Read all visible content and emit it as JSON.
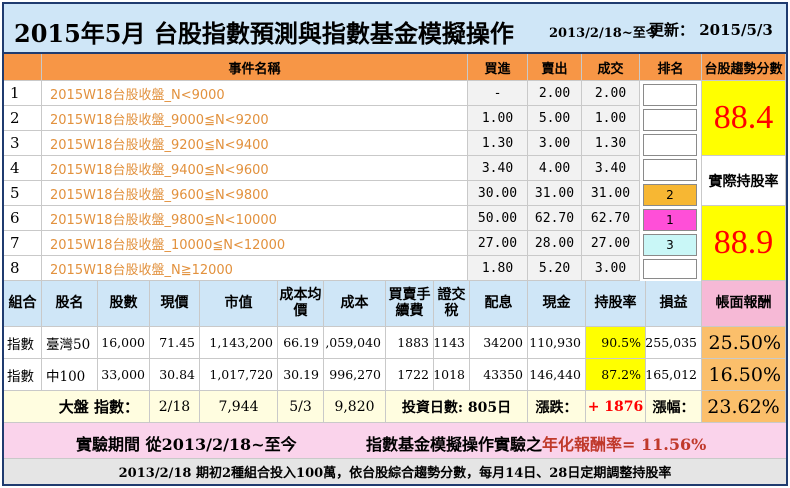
{
  "title": {
    "main": "2015年5月 台股指數預測與指數基金模擬操作",
    "range": "2013/2/18~至今",
    "update_label": "更新：",
    "update_date": "2015/5/3"
  },
  "header": {
    "event": "事件名稱",
    "buy": "買進",
    "sell": "賣出",
    "deal": "成交",
    "rank": "排名",
    "trend_score": "台股趨勢分數"
  },
  "events": [
    {
      "num": "1",
      "name": "2015W18台股收盤_N<9000",
      "buy": "-",
      "sell": "2.00",
      "deal": "2.00"
    },
    {
      "num": "2",
      "name": "2015W18台股收盤_9000≦N<9200",
      "buy": "1.00",
      "sell": "5.00",
      "deal": "1.00"
    },
    {
      "num": "3",
      "name": "2015W18台股收盤_9200≦N<9400",
      "buy": "1.30",
      "sell": "3.00",
      "deal": "1.30"
    },
    {
      "num": "4",
      "name": "2015W18台股收盤_9400≦N<9600",
      "buy": "3.40",
      "sell": "4.00",
      "deal": "3.40"
    },
    {
      "num": "5",
      "name": "2015W18台股收盤_9600≦N<9800",
      "buy": "30.00",
      "sell": "31.00",
      "deal": "31.00"
    },
    {
      "num": "6",
      "name": "2015W18台股收盤_9800≦N<10000",
      "buy": "50.00",
      "sell": "62.70",
      "deal": "62.70"
    },
    {
      "num": "7",
      "name": "2015W18台股收盤_10000≦N<12000",
      "buy": "27.00",
      "sell": "28.00",
      "deal": "27.00"
    },
    {
      "num": "8",
      "name": "2015W18台股收盤_N≧12000",
      "buy": "1.80",
      "sell": "5.20",
      "deal": "3.00"
    }
  ],
  "ranks": {
    "r5": "2",
    "r6": "1",
    "r7": "3"
  },
  "rank_colors": {
    "r5": "#f7b733",
    "r6": "#ff4fd8",
    "r7": "#c9f7f7"
  },
  "trend_score": "88.4",
  "actual_holding_label": "實際持股率",
  "actual_holding": "88.9",
  "portfolio": {
    "headers": {
      "group": "組合",
      "name": "股名",
      "shares": "股數",
      "price": "現價",
      "market_value": "市值",
      "avg_cost": "成本均價",
      "cost": "成本",
      "fee": "買賣手續費",
      "tax": "證交稅",
      "dividend": "配息",
      "cash": "現金",
      "holding_rate": "持股率",
      "pnl": "損益",
      "book_return": "帳面報酬"
    },
    "rows": [
      {
        "group": "指數",
        "name": "臺灣50",
        "shares": "16,000",
        "price": "71.45",
        "market_value": "1,143,200",
        "avg_cost": "66.19",
        "cost": "1,059,040",
        "fee": "1883",
        "tax": "1143",
        "dividend": "34200",
        "cash": "110,930",
        "holding_rate": "90.5%",
        "pnl": "255,035",
        "book_return": "25.50%"
      },
      {
        "group": "指數",
        "name": "中100",
        "shares": "33,000",
        "price": "30.84",
        "market_value": "1,017,720",
        "avg_cost": "30.19",
        "cost": "996,270",
        "fee": "1722",
        "tax": "1018",
        "dividend": "43350",
        "cash": "146,440",
        "holding_rate": "87.2%",
        "pnl": "165,012",
        "book_return": "16.50%"
      }
    ],
    "summary": {
      "index_label": "大盤 指數：",
      "date1": "2/18",
      "value1": "7,944",
      "date2": "5/3",
      "value2": "9,820",
      "invest_days": "投資日數: 805日",
      "change_label": "漲跌：",
      "change_value": "+ 1876",
      "rise_label": "漲幅：",
      "rise_value": "23.62%"
    }
  },
  "experiment": {
    "period": "實驗期間 從2013/2/18~至今",
    "desc_prefix": "指數基金模擬操作實驗之",
    "desc_highlight": "年化報酬率",
    "desc_value": "= 11.56%"
  },
  "footer": "2013/2/18 期初2種組合投入100萬，依台股綜合趨勢分數，每月14日、28日定期調整持股率"
}
